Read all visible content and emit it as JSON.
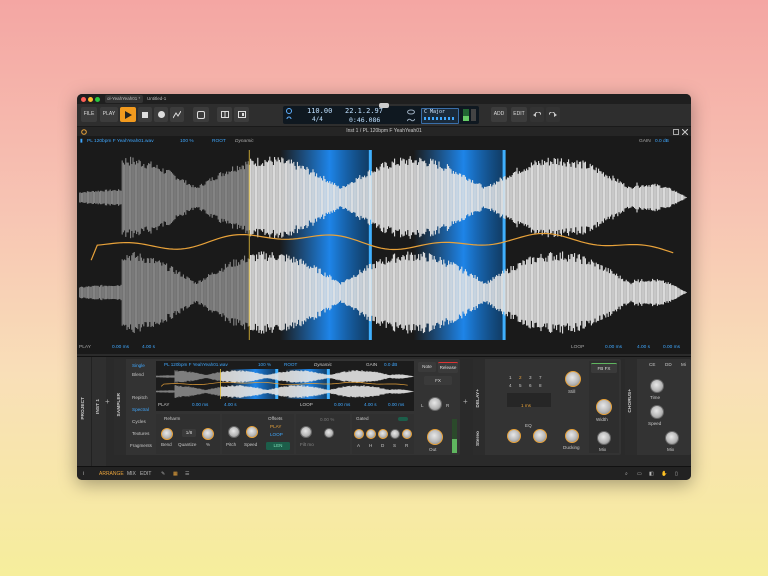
{
  "window": {
    "tabs": [
      "ol-YeahYeah01 *",
      "Untitled-1"
    ],
    "traffic_colors": [
      "#ff5f57",
      "#febc2e",
      "#28c840"
    ]
  },
  "toolbar": {
    "file": "FILE",
    "play": "PLAY",
    "add": "ADD",
    "edit": "EDIT"
  },
  "transport": {
    "tempo": "110.00",
    "time_sig": "4/4",
    "position": "22.1.2.97",
    "time": "0:46.086",
    "key": "C Major"
  },
  "inspector": {
    "title": "Inst 1 / PL 120bpm F YeahYeah01"
  },
  "editor": {
    "file": "PL 120bpm F YeahYeah01.wav",
    "speed": "100 %",
    "root": "ROOT",
    "mode": "Dynamic",
    "gain_label": "GAIN",
    "gain_value": "0.0 dB",
    "play_label": "PLAY",
    "play_start": "0.00 ms",
    "play_end": "4.00 s",
    "loop_label": "LOOP",
    "loop_start": "0.00 ms",
    "loop_mid": "4.00 s",
    "loop_end": "0.00 ms"
  },
  "devices": {
    "project": "PROJECT",
    "inst": "INST 1",
    "sampler": "SAMPLER",
    "modes": [
      "Single",
      "Blend",
      "Repitch",
      "Spectral",
      "Cycles",
      "Textures",
      "Fragments"
    ],
    "mini_file": "PL 120bpm F YeahYeah01.wav",
    "mini_speed": "100 %",
    "mini_root": "ROOT",
    "mini_mode": "Dynamic",
    "mini_gain": "GAIN",
    "mini_gain_value": "0.0 dB",
    "mini_play": "PLAY",
    "mini_play_start": "0.00 ms",
    "mini_play_end": "4.00 s",
    "mini_loop": "LOOP",
    "mini_loop_a": "0.00 ms",
    "mini_loop_b": "4.00 s",
    "mini_loop_c": "0.00 ms",
    "note": "Note",
    "release": "Release",
    "fx": "FX",
    "lr_left": "L",
    "lr_right": "R",
    "out": "Out",
    "reharm": "Reharm",
    "bend": "Bend",
    "quantize": "Quantize",
    "quant_val": "1/8",
    "pct": "%",
    "pitch": "Pitch",
    "speed": "Speed",
    "offsets": "Offsets",
    "off_play": "PLAY",
    "off_loop": "LOOP",
    "off_len": "LEN",
    "filter_val": "0.00 %",
    "filter_lbl": "Filt mo",
    "gated": "Gated",
    "adsr": [
      "A",
      "H",
      "D",
      "S",
      "R"
    ],
    "delay": "DELAY+",
    "stereo": "Stereo",
    "eq": "EQ",
    "time_val": "1 ms",
    "still": "Still",
    "width": "Width",
    "ducking": "Ducking",
    "mix": "Mix",
    "fb_fx": "FB FX",
    "chorus": "CHORUS+",
    "ch_tabs": [
      "CE",
      "DD",
      "Mi"
    ],
    "ch_time": "Time",
    "ch_speed": "Speed",
    "ch_mix": "Mix",
    "grid_nums": [
      "1",
      "2",
      "3",
      "4",
      "5",
      "6",
      "7",
      "8"
    ]
  },
  "statusbar": {
    "arrange": "ARRANGE",
    "mix": "MIX",
    "edit": "EDIT"
  },
  "colors": {
    "accent": "#e8a23a",
    "highlight": "#1e90ff",
    "bg": "#2b2b2b"
  }
}
